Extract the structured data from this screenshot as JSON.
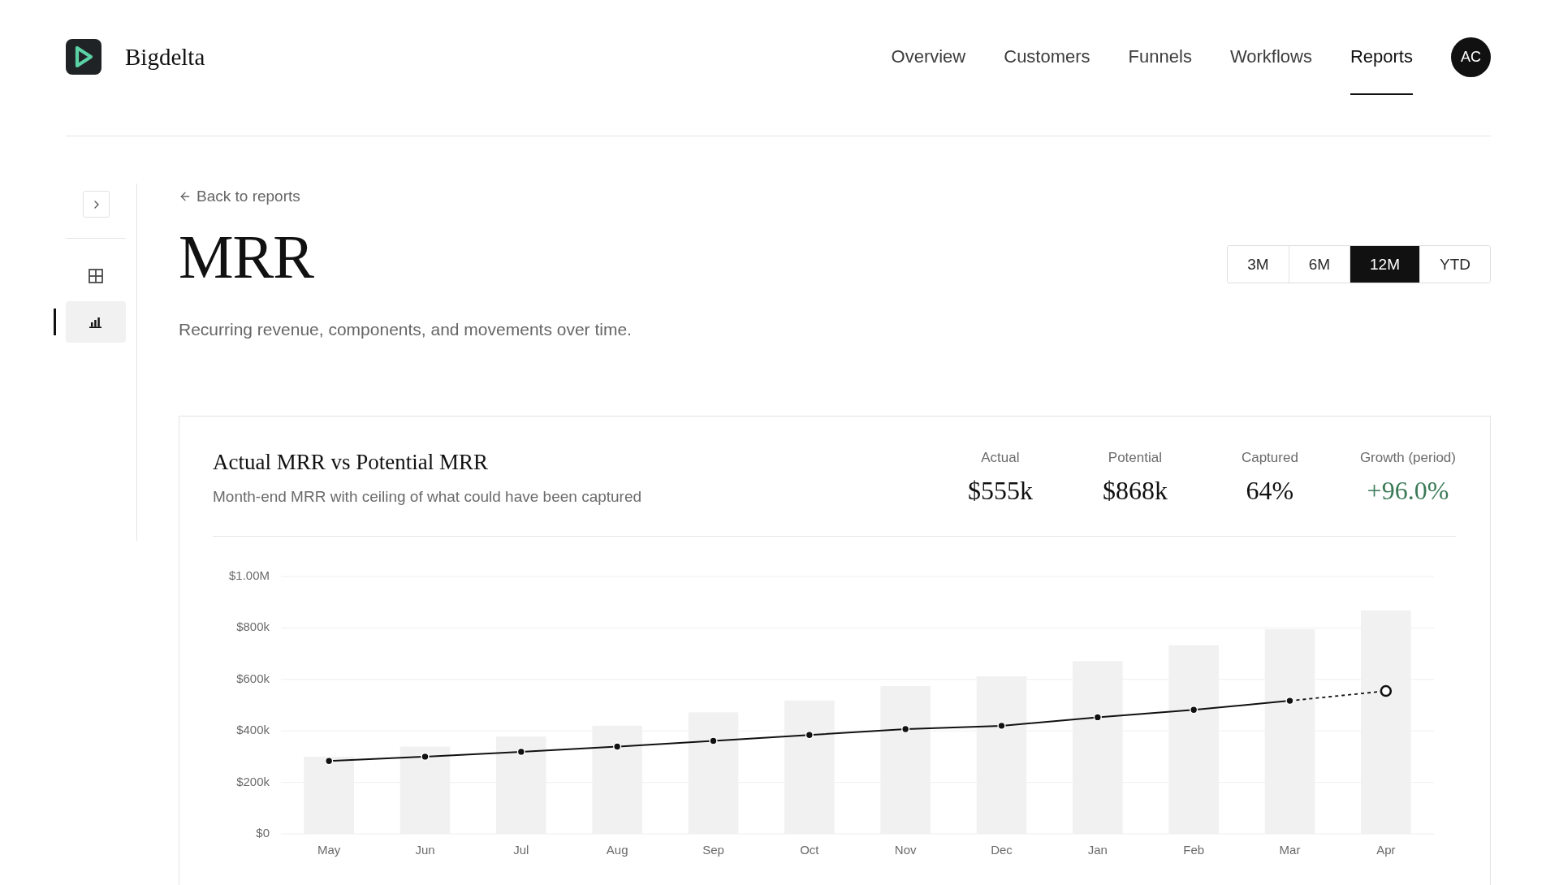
{
  "header": {
    "brand": "Bigdelta",
    "nav": [
      {
        "label": "Overview",
        "selected": false
      },
      {
        "label": "Customers",
        "selected": false
      },
      {
        "label": "Funnels",
        "selected": false
      },
      {
        "label": "Workflows",
        "selected": false
      },
      {
        "label": "Reports",
        "selected": true
      }
    ],
    "avatar": {
      "initials": "AC"
    }
  },
  "sidebar": {
    "expanded": false,
    "items": [
      {
        "selected": false
      },
      {
        "selected": true
      }
    ]
  },
  "page": {
    "back_link": "Back to reports",
    "title": "MRR",
    "ranges": [
      {
        "label": "3M",
        "selected": false
      },
      {
        "label": "6M",
        "selected": false
      },
      {
        "label": "12M",
        "selected": true
      },
      {
        "label": "YTD",
        "selected": false
      }
    ],
    "subtitle": "Recurring revenue, components, and movements over time."
  },
  "card": {
    "title": "Actual MRR vs Potential MRR",
    "subtitle": "Month-end MRR with ceiling of what could have been captured",
    "stats": [
      {
        "label": "Actual",
        "value": "$555k",
        "color": "#111111"
      },
      {
        "label": "Potential",
        "value": "$868k",
        "color": "#111111"
      },
      {
        "label": "Captured",
        "value": "64%",
        "color": "#111111"
      },
      {
        "label": "Growth (period)",
        "value": "+96.0%",
        "color": "#3c7a58"
      }
    ],
    "last_point_projected": true,
    "chart_data": {
      "type": "bar",
      "stacked": false,
      "grid": true,
      "categories": [
        "May",
        "Jun",
        "Jul",
        "Aug",
        "Sep",
        "Oct",
        "Nov",
        "Dec",
        "Jan",
        "Feb",
        "Mar",
        "Apr"
      ],
      "series": [
        {
          "color": "#f1f1f1",
          "values": [
            300000,
            339000,
            378000,
            420000,
            472000,
            518000,
            574000,
            612000,
            671000,
            733000,
            795000,
            868000
          ]
        },
        {
          "type": "line",
          "marker": "circle",
          "color": "#111111",
          "values": [
            283000,
            300000,
            319000,
            339000,
            361000,
            384000,
            407000,
            420000,
            453000,
            482000,
            517000,
            555000
          ]
        }
      ],
      "ylim": [
        0,
        1000000
      ],
      "yticks": [
        {
          "value": 0,
          "label": "$0"
        },
        {
          "value": 200000,
          "label": "$200k"
        },
        {
          "value": 400000,
          "label": "$400k"
        },
        {
          "value": 600000,
          "label": "$600k"
        },
        {
          "value": 800000,
          "label": "$800k"
        },
        {
          "value": 1000000,
          "label": "$1.00M"
        }
      ]
    }
  }
}
